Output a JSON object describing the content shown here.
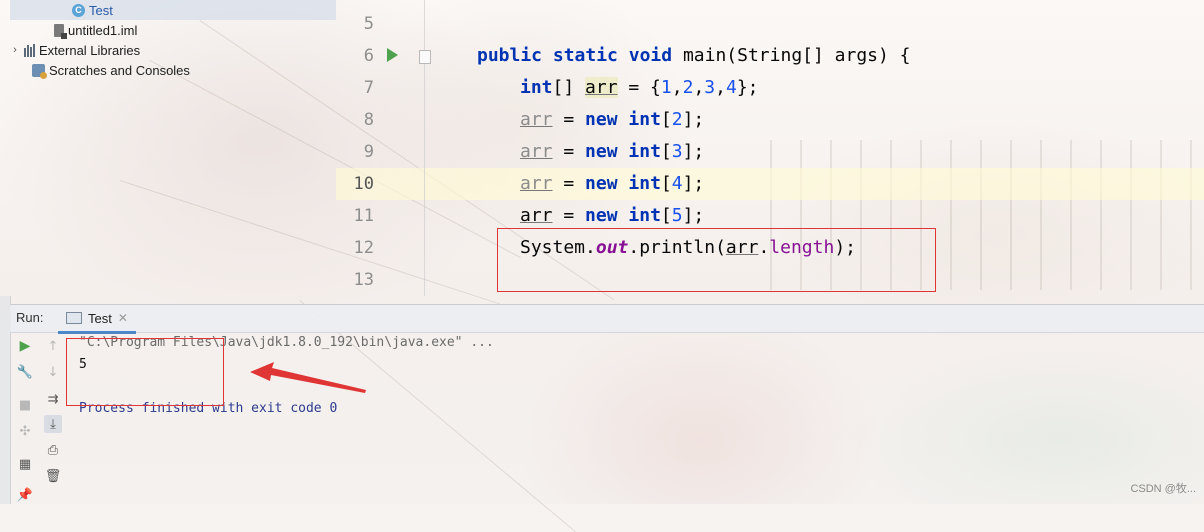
{
  "project_tree": {
    "items": [
      {
        "label": "Test",
        "icon": "java-class-icon",
        "selected": true
      },
      {
        "label": "untitled1.iml",
        "icon": "iml-file-icon"
      },
      {
        "label": "External Libraries",
        "icon": "libraries-icon",
        "collapsed": true
      },
      {
        "label": "Scratches and Consoles",
        "icon": "scratches-icon"
      }
    ]
  },
  "editor": {
    "line_numbers": [
      "5",
      "6",
      "7",
      "8",
      "9",
      "10",
      "11",
      "12",
      "13"
    ],
    "current_line": "10",
    "code": {
      "l6": {
        "k1": "public",
        "k2": "static",
        "k3": "void",
        "rest": " main(String[] args) {"
      },
      "l7": {
        "type": "int",
        "t1": "[] ",
        "var": "arr",
        "t2": " = {",
        "n1": "1",
        "c1": ",",
        "n2": "2",
        "c2": ",",
        "n3": "3",
        "c3": ",",
        "n4": "4",
        "end": "};"
      },
      "l8": {
        "var": "arr",
        "eq": " = ",
        "kw": "new",
        "type": "int",
        "open": "[",
        "num": "2",
        "close": "];"
      },
      "l9": {
        "var": "arr",
        "eq": " = ",
        "kw": "new",
        "type": "int",
        "open": "[",
        "num": "3",
        "close": "];"
      },
      "l10": {
        "var": "arr",
        "eq": " = ",
        "kw": "new",
        "type": "int",
        "open": "[",
        "num": "4",
        "close": "];"
      },
      "l11": {
        "var": "arr",
        "eq": " = ",
        "kw": "new",
        "type": "int",
        "open": "[",
        "num": "5",
        "close": "];"
      },
      "l12": {
        "pre": "System.",
        "out": "out",
        "mid": ".println(",
        "var": "arr",
        "dot": ".",
        "field": "length",
        "end": ");"
      }
    }
  },
  "run_panel": {
    "title": "Run:",
    "tab_label": "Test",
    "command": "\"C:\\Program Files\\Java\\jdk1.8.0_192\\bin\\java.exe\" ...",
    "output": "5",
    "exit_message": "Process finished with exit code 0"
  },
  "watermark": "CSDN @牧...",
  "colors": {
    "keyword": "#0033b3",
    "number": "#1750eb",
    "field": "#871094",
    "annotation_red": "#e03535",
    "run_green": "#4ea24e"
  }
}
